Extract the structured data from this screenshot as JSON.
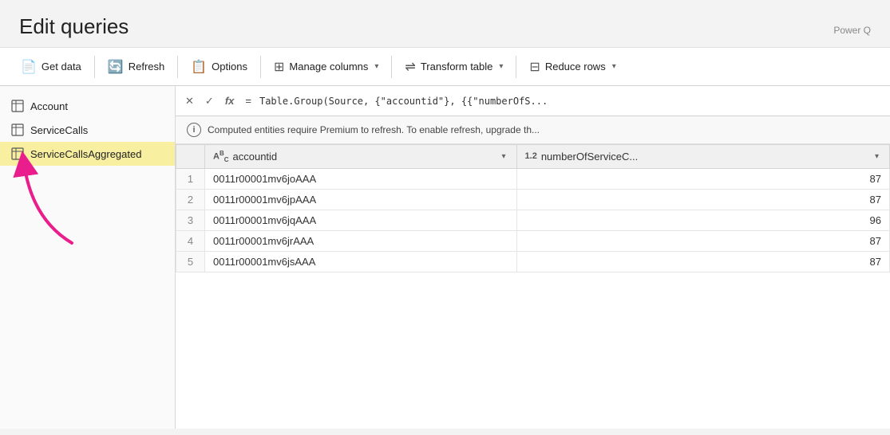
{
  "app": {
    "title": "Edit queries",
    "power_label": "Power Q"
  },
  "toolbar": {
    "buttons": [
      {
        "id": "get-data",
        "label": "Get data",
        "icon": "📄"
      },
      {
        "id": "refresh",
        "label": "Refresh",
        "icon": "🔄"
      },
      {
        "id": "options",
        "label": "Options",
        "icon": "📋"
      },
      {
        "id": "manage-columns",
        "label": "Manage columns",
        "icon": "⊞",
        "has_chevron": true
      },
      {
        "id": "transform-table",
        "label": "Transform table",
        "icon": "⇌",
        "has_chevron": true
      },
      {
        "id": "reduce-rows",
        "label": "Reduce rows",
        "icon": "⊟",
        "has_chevron": true
      }
    ]
  },
  "sidebar": {
    "items": [
      {
        "id": "account",
        "label": "Account",
        "icon": "table"
      },
      {
        "id": "service-calls",
        "label": "ServiceCalls",
        "icon": "table"
      },
      {
        "id": "service-calls-aggregated",
        "label": "ServiceCallsAggregated",
        "icon": "table",
        "active": true
      }
    ]
  },
  "formula_bar": {
    "cancel_label": "✕",
    "confirm_label": "✓",
    "fx_label": "fx",
    "equals": "=",
    "formula": "Table.Group(Source, {\"accountid\"}, {{\"numberOfS..."
  },
  "info_bar": {
    "message": "Computed entities require Premium to refresh. To enable refresh, upgrade th..."
  },
  "table": {
    "columns": [
      {
        "id": "row-num",
        "label": ""
      },
      {
        "id": "accountid",
        "label": "accountid",
        "type": "ABC"
      },
      {
        "id": "numberOfServiceC",
        "label": "numberOfServiceC...",
        "type": "1.2"
      }
    ],
    "rows": [
      {
        "num": 1,
        "accountid": "0011r00001mv6joAAA",
        "numberOfServiceC": 87
      },
      {
        "num": 2,
        "accountid": "0011r00001mv6jpAAA",
        "numberOfServiceC": 87
      },
      {
        "num": 3,
        "accountid": "0011r00001mv6jqAAA",
        "numberOfServiceC": 96
      },
      {
        "num": 4,
        "accountid": "0011r00001mv6jrAAA",
        "numberOfServiceC": 87
      },
      {
        "num": 5,
        "accountid": "0011r00001mv6jsAAA",
        "numberOfServiceC": 87
      }
    ]
  }
}
